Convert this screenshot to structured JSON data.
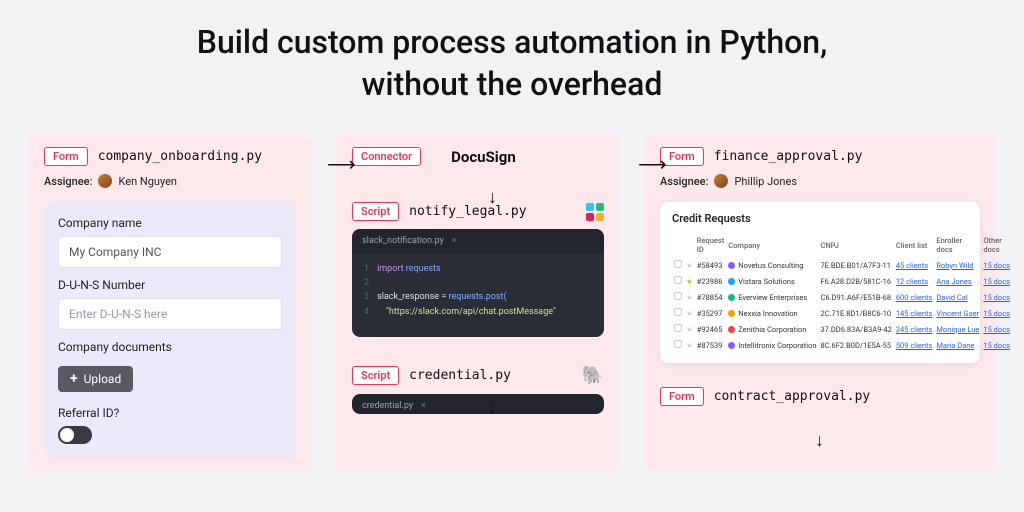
{
  "hero": {
    "line1": "Build custom process automation in Python,",
    "line2": "without the overhead"
  },
  "badges": {
    "form": "Form",
    "connector": "Connector",
    "script": "Script"
  },
  "left": {
    "filename": "company_onboarding.py",
    "assignee_label": "Assignee:",
    "assignee_name": "Ken Nguyen",
    "field1_label": "Company name",
    "field1_value": "My Company INC",
    "field2_label": "D-U-N-S Number",
    "field2_placeholder": "Enter D-U-N-S here",
    "docs_label": "Company documents",
    "upload_label": "Upload",
    "referral_label": "Referral ID?"
  },
  "mid": {
    "connector_name": "DocuSign",
    "script1_filename": "notify_legal.py",
    "script1_tab": "slack_notification.py",
    "code": {
      "l1_kw": "import",
      "l1_mod": "requests",
      "l3_var": "slack_response",
      "l3_eq": " = ",
      "l3_call": "requests.post(",
      "l4_str": "\"https://slack.com/api/chat.postMessage\""
    },
    "script2_filename": "credential.py",
    "script2_tab": "credential.py"
  },
  "right": {
    "filename": "finance_approval.py",
    "assignee_label": "Assignee:",
    "assignee_name": "Phillip Jones",
    "table_title": "Credit Requests",
    "cols": [
      "Request ID",
      "Company",
      "CNPJ",
      "Client list",
      "Enroller docs",
      "Other docs"
    ],
    "rows": [
      {
        "star": false,
        "id": "#58493",
        "company": "Novetus Consulting",
        "dot": "#7c5cff",
        "cnpj": "7E.BDE.B01/A7F3-11",
        "clients": "45 clients",
        "enroller": "Robyn Wild",
        "docs": "15 docs"
      },
      {
        "star": true,
        "id": "#23986",
        "company": "Vistara Solutions",
        "dot": "#18a0fb",
        "cnpj": "F6.A28.D2B/581C-16",
        "clients": "12 clients",
        "enroller": "Ana Jones",
        "docs": "15 docs"
      },
      {
        "star": false,
        "id": "#78854",
        "company": "Everview Enterprises",
        "dot": "#10b981",
        "cnpj": "C6.D91.A6F/E51B-68",
        "clients": "600 clients",
        "enroller": "David Cal",
        "docs": "15 docs"
      },
      {
        "star": false,
        "id": "#35297",
        "company": "Nexxia Innovation",
        "dot": "#f59e0b",
        "cnpj": "2C.71E.8D1/B8C6-10",
        "clients": "145 clients",
        "enroller": "Vincent Gaer",
        "docs": "15 docs"
      },
      {
        "star": false,
        "id": "#92465",
        "company": "Zenithia Corporation",
        "dot": "#ef4444",
        "cnpj": "37.DD6.83A/B3A9-42",
        "clients": "245 clients",
        "enroller": "Monique Lue",
        "docs": "15 docs"
      },
      {
        "star": false,
        "id": "#87539",
        "company": "Intellitronix Corporation",
        "dot": "#8b5cf6",
        "cnpj": "8C.6F2.B0D/1E5A-55",
        "clients": "509 clients",
        "enroller": "Maria Dane",
        "docs": "15 docs"
      }
    ],
    "form2_filename": "contract_approval.py"
  }
}
